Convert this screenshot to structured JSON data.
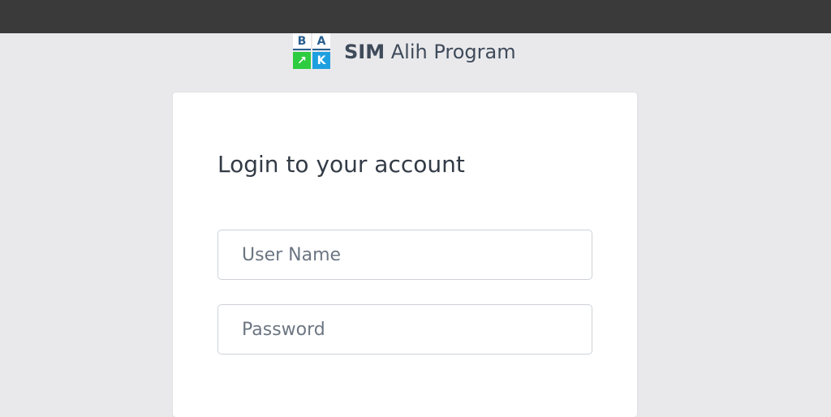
{
  "brand": {
    "logo_letters": [
      "B",
      "A",
      "↗",
      "K"
    ],
    "name_strong": "SIM",
    "name_rest": " Alih Program"
  },
  "login": {
    "title": "Login to your account",
    "username_placeholder": "User Name",
    "password_placeholder": "Password"
  },
  "colors": {
    "topbar": "#3a3a3a",
    "background": "#e9e9ec",
    "logo_green": "#2ecc40",
    "logo_blue": "#1ea0e0"
  }
}
